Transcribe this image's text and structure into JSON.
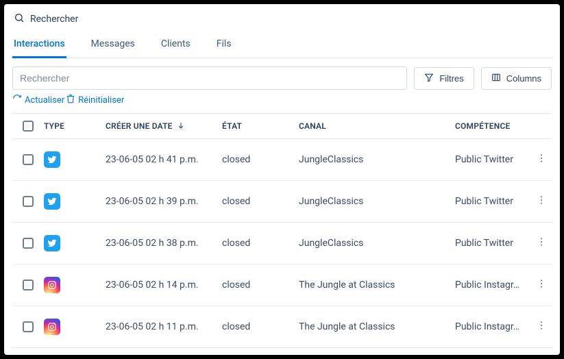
{
  "searchTop": "Rechercher",
  "tabs": [
    "Interactions",
    "Messages",
    "Clients",
    "Fils"
  ],
  "activeTab": 0,
  "searchPlaceholder": "Rechercher",
  "filterBtn": "Filtres",
  "columnsBtn": "Columns",
  "actualiser": "Actualiser",
  "reinitialiser": "Réinitialiser",
  "headers": {
    "type": "TYPE",
    "date": "CRÉER UNE DATE",
    "etat": "ÉTAT",
    "canal": "CANAL",
    "competence": "COMPÉTENCE"
  },
  "rows": [
    {
      "type": "twitter",
      "date": "23-06-05 02 h 41 p.m.",
      "etat": "closed",
      "canal": "JungleClassics",
      "competence": "Public Twitter"
    },
    {
      "type": "twitter",
      "date": "23-06-05 02 h 39 p.m.",
      "etat": "closed",
      "canal": "JungleClassics",
      "competence": "Public Twitter"
    },
    {
      "type": "twitter",
      "date": "23-06-05 02 h 38 p.m.",
      "etat": "closed",
      "canal": "JungleClassics",
      "competence": "Public Twitter"
    },
    {
      "type": "instagram",
      "date": "23-06-05 02 h 14 p.m.",
      "etat": "closed",
      "canal": "The Jungle at Classics",
      "competence": "Public Instagr…"
    },
    {
      "type": "instagram",
      "date": "23-06-05 02 h 11 p.m.",
      "etat": "closed",
      "canal": "The Jungle at Classics",
      "competence": "Public Instagr…"
    }
  ]
}
